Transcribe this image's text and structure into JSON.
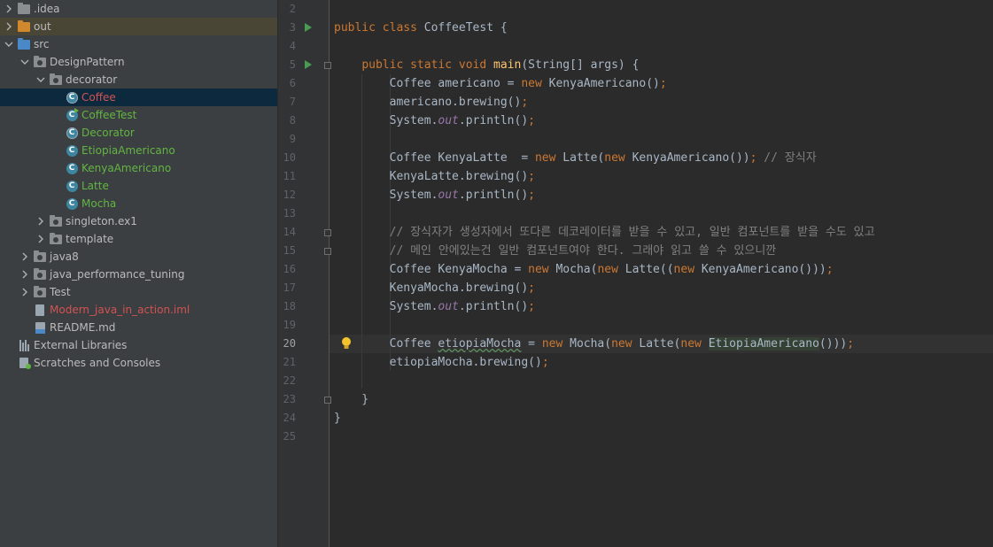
{
  "project_tree": [
    {
      "label": ".idea",
      "depth": 0,
      "arrow": "right",
      "icon": "folder-icon",
      "color": "#bbbbbb"
    },
    {
      "label": "out",
      "depth": 0,
      "arrow": "right",
      "icon": "folder-out-icon",
      "color": "#bbbbbb",
      "highlight": true
    },
    {
      "label": "src",
      "depth": 0,
      "arrow": "down",
      "icon": "folder-src-icon",
      "color": "#bbbbbb"
    },
    {
      "label": "DesignPattern",
      "depth": 1,
      "arrow": "down",
      "icon": "package-icon",
      "color": "#bbbbbb"
    },
    {
      "label": "decorator",
      "depth": 2,
      "arrow": "down",
      "icon": "package-icon",
      "color": "#bbbbbb"
    },
    {
      "label": "Coffee",
      "depth": 3,
      "arrow": "none",
      "icon": "abstract-class-icon",
      "color": "#d25252",
      "selected": true
    },
    {
      "label": "CoffeeTest",
      "depth": 3,
      "arrow": "none",
      "icon": "class-run-icon",
      "color": "#62b543"
    },
    {
      "label": "Decorator",
      "depth": 3,
      "arrow": "none",
      "icon": "abstract-class-icon",
      "color": "#62b543"
    },
    {
      "label": "EtiopiaAmericano",
      "depth": 3,
      "arrow": "none",
      "icon": "class-icon",
      "color": "#62b543"
    },
    {
      "label": "KenyaAmericano",
      "depth": 3,
      "arrow": "none",
      "icon": "class-icon",
      "color": "#62b543"
    },
    {
      "label": "Latte",
      "depth": 3,
      "arrow": "none",
      "icon": "class-icon",
      "color": "#62b543"
    },
    {
      "label": "Mocha",
      "depth": 3,
      "arrow": "none",
      "icon": "class-icon",
      "color": "#62b543"
    },
    {
      "label": "singleton.ex1",
      "depth": 2,
      "arrow": "right",
      "icon": "package-icon",
      "color": "#bbbbbb"
    },
    {
      "label": "template",
      "depth": 2,
      "arrow": "right",
      "icon": "package-icon",
      "color": "#bbbbbb"
    },
    {
      "label": "java8",
      "depth": 1,
      "arrow": "right",
      "icon": "package-icon",
      "color": "#bbbbbb"
    },
    {
      "label": "java_performance_tuning",
      "depth": 1,
      "arrow": "right",
      "icon": "package-icon",
      "color": "#bbbbbb"
    },
    {
      "label": "Test",
      "depth": 1,
      "arrow": "right",
      "icon": "package-icon",
      "color": "#bbbbbb"
    },
    {
      "label": "Modern_java_in_action.iml",
      "depth": 1,
      "arrow": "none",
      "icon": "iml-file-icon",
      "color": "#d25252"
    },
    {
      "label": "README.md",
      "depth": 1,
      "arrow": "none",
      "icon": "markdown-file-icon",
      "color": "#bbbbbb"
    },
    {
      "label": "External Libraries",
      "depth": 0,
      "arrow": "none",
      "icon": "libraries-icon",
      "color": "#bbbbbb"
    },
    {
      "label": "Scratches and Consoles",
      "depth": 0,
      "arrow": "none",
      "icon": "scratches-icon",
      "color": "#bbbbbb"
    }
  ],
  "editor": {
    "current_line": "20",
    "lines": [
      {
        "n": "2",
        "tokens": []
      },
      {
        "n": "3",
        "run": true,
        "tokens": [
          [
            "kw",
            "public class "
          ],
          [
            "",
            "CoffeeTest {"
          ]
        ]
      },
      {
        "n": "4",
        "tokens": []
      },
      {
        "n": "5",
        "run": true,
        "fold": true,
        "tokens": [
          [
            "",
            "    "
          ],
          [
            "kw",
            "public static void "
          ],
          [
            "fn",
            "main"
          ],
          [
            "",
            "(String[] args) {"
          ]
        ]
      },
      {
        "n": "6",
        "tokens": [
          [
            "",
            "        Coffee americano = "
          ],
          [
            "kw",
            "new "
          ],
          [
            "",
            "KenyaAmericano()"
          ],
          [
            "kw",
            ";"
          ]
        ]
      },
      {
        "n": "7",
        "tokens": [
          [
            "",
            "        americano.brewing()"
          ],
          [
            "kw",
            ";"
          ]
        ]
      },
      {
        "n": "8",
        "tokens": [
          [
            "",
            "        System."
          ],
          [
            "fld",
            "out"
          ],
          [
            "",
            ".println()"
          ],
          [
            "kw",
            ";"
          ]
        ]
      },
      {
        "n": "9",
        "tokens": []
      },
      {
        "n": "10",
        "tokens": [
          [
            "",
            "        Coffee KenyaLatte  = "
          ],
          [
            "kw",
            "new "
          ],
          [
            "",
            "Latte("
          ],
          [
            "kw",
            "new "
          ],
          [
            "",
            "KenyaAmericano())"
          ],
          [
            "kw",
            ";"
          ],
          [
            "cm",
            " // 장식자"
          ]
        ]
      },
      {
        "n": "11",
        "tokens": [
          [
            "",
            "        KenyaLatte.brewing()"
          ],
          [
            "kw",
            ";"
          ]
        ]
      },
      {
        "n": "12",
        "tokens": [
          [
            "",
            "        System."
          ],
          [
            "fld",
            "out"
          ],
          [
            "",
            ".println()"
          ],
          [
            "kw",
            ";"
          ]
        ]
      },
      {
        "n": "13",
        "tokens": []
      },
      {
        "n": "14",
        "fold": true,
        "tokens": [
          [
            "cm",
            "        // 장식자가 생성자에서 또다른 데코레이터를 받을 수 있고, 일반 컴포넌트를 받을 수도 있고"
          ]
        ]
      },
      {
        "n": "15",
        "fold": true,
        "tokens": [
          [
            "cm",
            "        // 메인 안에있는건 일반 컴포넌트여야 한다. 그래야 읽고 쓸 수 있으니깐"
          ]
        ]
      },
      {
        "n": "16",
        "tokens": [
          [
            "",
            "        Coffee KenyaMocha = "
          ],
          [
            "kw",
            "new "
          ],
          [
            "",
            "Mocha("
          ],
          [
            "kw",
            "new "
          ],
          [
            "",
            "Latte(("
          ],
          [
            "kw",
            "new "
          ],
          [
            "",
            "KenyaAmericano()))"
          ],
          [
            "kw",
            ";"
          ]
        ]
      },
      {
        "n": "17",
        "tokens": [
          [
            "",
            "        KenyaMocha.brewing()"
          ],
          [
            "kw",
            ";"
          ]
        ]
      },
      {
        "n": "18",
        "tokens": [
          [
            "",
            "        System."
          ],
          [
            "fld",
            "out"
          ],
          [
            "",
            ".println()"
          ],
          [
            "kw",
            ";"
          ]
        ]
      },
      {
        "n": "19",
        "tokens": []
      },
      {
        "n": "20",
        "bulb": true,
        "tokens": [
          [
            "",
            "        Coffee "
          ],
          [
            "warn",
            "etiopiaMocha"
          ],
          [
            "",
            " = "
          ],
          [
            "kw",
            "new "
          ],
          [
            "",
            "Mocha("
          ],
          [
            "kw",
            "new "
          ],
          [
            "",
            "Latte("
          ],
          [
            "kw",
            "new "
          ],
          [
            "hlname",
            "EtiopiaAmericano"
          ],
          [
            "",
            "()))"
          ],
          [
            "kw",
            ";"
          ]
        ]
      },
      {
        "n": "21",
        "tokens": [
          [
            "",
            "        etiopiaMocha.brewing()"
          ],
          [
            "kw",
            ";"
          ]
        ]
      },
      {
        "n": "22",
        "tokens": []
      },
      {
        "n": "23",
        "fold": true,
        "tokens": [
          [
            "",
            "    }"
          ]
        ]
      },
      {
        "n": "24",
        "tokens": [
          [
            "",
            "}"
          ]
        ]
      },
      {
        "n": "25",
        "tokens": []
      }
    ]
  },
  "colors": {
    "keyword": "#cc7832",
    "method_decl": "#ffc66d",
    "static_field": "#9876aa",
    "comment": "#808080",
    "default_text": "#a9b7c6",
    "run_arrow": "#499c54",
    "selection": "#0d293e"
  }
}
